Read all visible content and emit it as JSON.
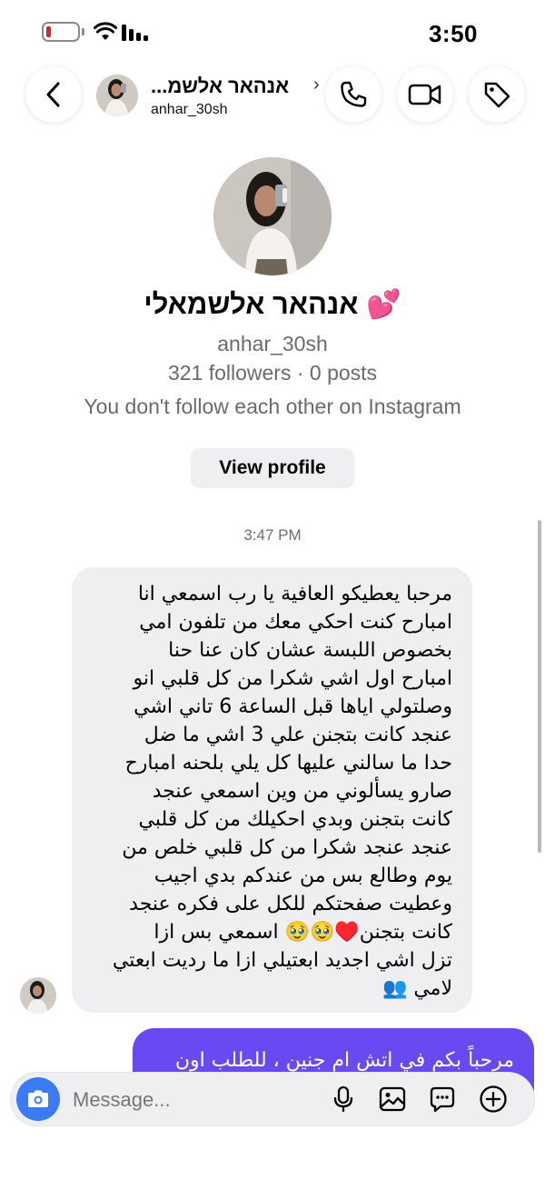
{
  "status_bar": {
    "time": "3:50"
  },
  "header": {
    "name": "אנהאר אלשמ...",
    "username": "anhar_30sh",
    "back_icon": "chevron-left-icon",
    "call_icon": "phone-icon",
    "video_icon": "video-camera-icon",
    "tag_icon": "tag-icon"
  },
  "profile": {
    "name": "אנהאר אלשמאלי 💕",
    "username": "anhar_30sh",
    "stats": "321 followers · 0 posts",
    "follow_status": "You don't follow each other on Instagram",
    "view_profile_label": "View profile"
  },
  "conversation": {
    "timestamp": "3:47 PM",
    "incoming_message": {
      "lines": [
        "مرحبا يعطيكو العافية يا رب اسمعي انا",
        "امبارح كنت احكي معك من تلفون امي",
        "بخصوص اللبسة عشان كان عنا حنا",
        "امبارح اول اشي شكرا من كل قلبي انو",
        "وصلتولي اياها قبل الساعة 6 تاني اشي",
        "عنجد كانت بتجنن علي 3 اشي ما ضل",
        "حدا ما سالني عليها كل يلي بلحنه امبارح",
        "صارو يسألوني من وين اسمعي عنجد",
        "كانت بتجنن وبدي احكيلك من كل قلبي",
        "عنجد عنجد شكرا من كل قلبي خلص من",
        "يوم وطالع بس من عندكم بدي اجيب",
        "وعطيت صفحتكم للكل على فكره عنجد",
        "كانت بتجنن♥️🥹🥹 اسمعي بس ازا",
        "تزل اشي اجديد ابعتيلي ازا ما رديت ابعتي",
        "لامي 👥"
      ]
    },
    "outgoing_message": {
      "text": "مرحباً بكم في اتش ام جنين ، للطلب اون"
    }
  },
  "composer": {
    "placeholder": "Message...",
    "camera_icon": "camera-icon",
    "mic_icon": "microphone-icon",
    "gallery_icon": "image-icon",
    "sticker_icon": "sticker-icon",
    "add_icon": "plus-circle-icon"
  },
  "colors": {
    "accent": "#6849f2",
    "camera": "#3b7bf6",
    "bubble_gray": "#efeff1"
  }
}
